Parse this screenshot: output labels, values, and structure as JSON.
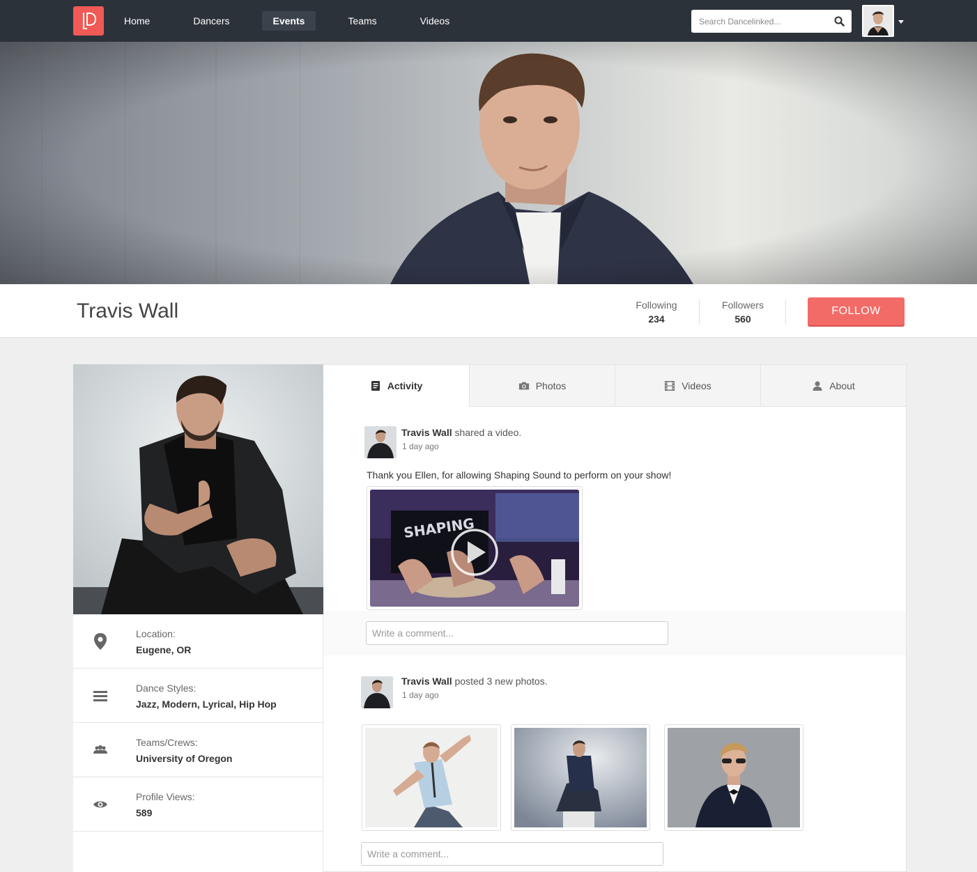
{
  "nav": {
    "logo_alt": "Dancelinked",
    "items": [
      {
        "label": "Home",
        "active": false
      },
      {
        "label": "Dancers",
        "active": false
      },
      {
        "label": "Events",
        "active": true
      },
      {
        "label": "Teams",
        "active": false
      },
      {
        "label": "Videos",
        "active": false
      }
    ],
    "search_placeholder": "Search Dancelinked..."
  },
  "profile": {
    "name": "Travis Wall",
    "following_label": "Following",
    "following_count": "234",
    "followers_label": "Followers",
    "followers_count": "560",
    "follow_button": "FOLLOW"
  },
  "info": [
    {
      "icon": "map-pin-icon",
      "label": "Location:",
      "value": "Eugene, OR"
    },
    {
      "icon": "list-icon",
      "label": "Dance Styles:",
      "value": "Jazz, Modern, Lyrical, Hip Hop"
    },
    {
      "icon": "group-icon",
      "label": "Teams/Crews:",
      "value": "University of Oregon"
    },
    {
      "icon": "eye-icon",
      "label": "Profile Views:",
      "value": "589"
    }
  ],
  "tabs": [
    {
      "label": "Activity",
      "icon": "document-icon",
      "active": true
    },
    {
      "label": "Photos",
      "icon": "camera-icon",
      "active": false
    },
    {
      "label": "Videos",
      "icon": "film-icon",
      "active": false
    },
    {
      "label": "About",
      "icon": "user-icon",
      "active": false
    }
  ],
  "posts": [
    {
      "author": "Travis Wall",
      "action": "shared a video.",
      "time": "1 day ago",
      "text": "Thank you Ellen, for allowing Shaping Sound to perform on your show!",
      "comment_placeholder": "Write a comment..."
    },
    {
      "author": "Travis Wall",
      "action": "posted 3 new photos.",
      "time": "1 day ago",
      "comment_placeholder": "Write a comment..."
    }
  ],
  "colors": {
    "topbar": "#2c323a",
    "accent": "#f26b66",
    "logo": "#f05a55"
  }
}
